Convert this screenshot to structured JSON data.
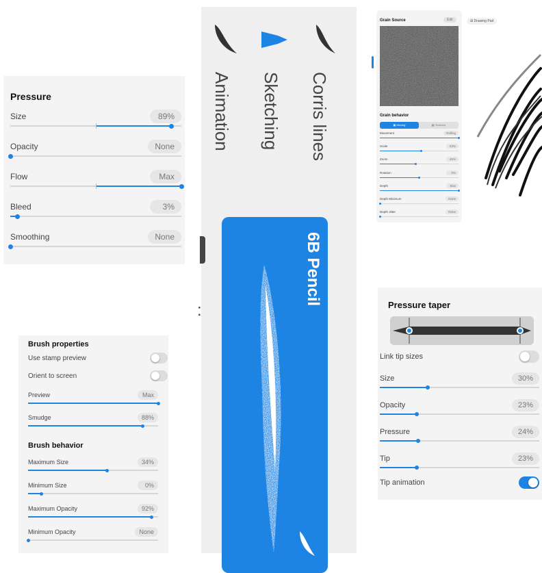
{
  "pressure": {
    "title": "Pressure",
    "rows": [
      {
        "label": "Size",
        "value": "89%",
        "level": 0.94,
        "center": 0.5
      },
      {
        "label": "Opacity",
        "value": "None",
        "level": 0.0,
        "center": null
      },
      {
        "label": "Flow",
        "value": "Max",
        "level": 1.0,
        "center": 0.5
      },
      {
        "label": "Bleed",
        "value": "3%",
        "level": 0.04,
        "center": null
      },
      {
        "label": "Smoothing",
        "value": "None",
        "level": 0.0,
        "center": null
      }
    ]
  },
  "brush_library": {
    "categories": [
      "Animation",
      "Sketching",
      "Corris lines"
    ],
    "selected_brush": "6B Pencil",
    "accent_color": "#1e84e4"
  },
  "grain": {
    "source_label": "Grain Source",
    "edit_label": "Edit",
    "drawing_pad_label": "Drawing Pad",
    "behavior_title": "Grain behavior",
    "modes": [
      "Moving",
      "Textured"
    ],
    "rows": [
      {
        "label": "Movement",
        "value": "Rolling",
        "level": 1.0
      },
      {
        "label": "Scale",
        "value": "53%",
        "level": 0.53
      },
      {
        "label": "Zoom",
        "value": "46%",
        "level": 0.46
      },
      {
        "label": "Rotation",
        "value": "0%",
        "level": 0.5
      },
      {
        "label": "Depth",
        "value": "Max",
        "level": 1.0
      },
      {
        "label": "Depth Minimum",
        "value": "None",
        "level": 0.0
      },
      {
        "label": "Depth Jitter",
        "value": "None",
        "level": 0.0
      }
    ]
  },
  "brush_properties": {
    "title": "Brush properties",
    "toggles": [
      {
        "label": "Use stamp preview",
        "on": false
      },
      {
        "label": "Orient to screen",
        "on": false
      }
    ],
    "rows": [
      {
        "label": "Preview",
        "value": "Max",
        "level": 1.0
      },
      {
        "label": "Smudge",
        "value": "88%",
        "level": 0.88
      }
    ],
    "behavior_title": "Brush behavior",
    "behavior_rows": [
      {
        "label": "Maximum Size",
        "value": "34%",
        "level": 0.61
      },
      {
        "label": "Minimum Size",
        "value": "0%",
        "level": 0.1
      },
      {
        "label": "Maximum Opacity",
        "value": "92%",
        "level": 0.95
      },
      {
        "label": "Minimum Opacity",
        "value": "None",
        "level": 0.0
      }
    ]
  },
  "pressure_taper": {
    "title": "Pressure taper",
    "link_label": "Link tip sizes",
    "link_on": false,
    "rows": [
      {
        "label": "Size",
        "value": "30%",
        "level": 0.3
      },
      {
        "label": "Opacity",
        "value": "23%",
        "level": 0.23
      },
      {
        "label": "Pressure",
        "value": "24%",
        "level": 0.24
      },
      {
        "label": "Tip",
        "value": "23%",
        "level": 0.23
      }
    ],
    "tip_animation_label": "Tip animation",
    "tip_animation_on": true
  }
}
